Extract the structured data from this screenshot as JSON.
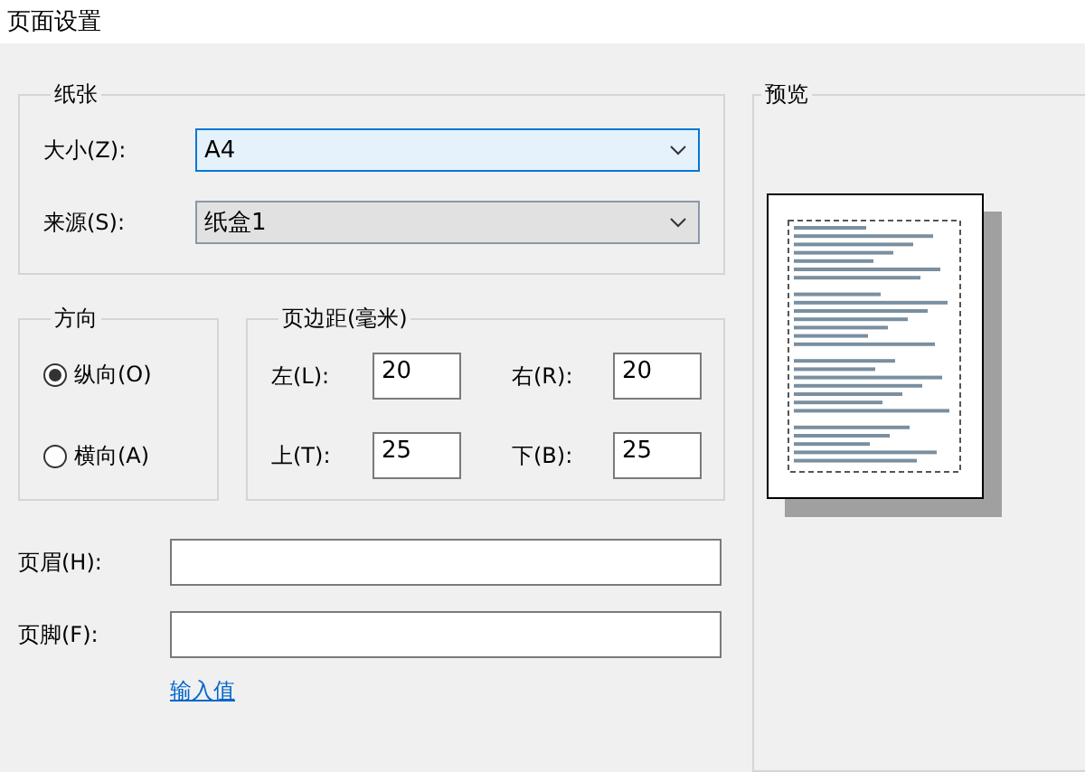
{
  "window": {
    "title": "页面设置"
  },
  "paper": {
    "title": "纸张",
    "size": {
      "label": "大小(Z):",
      "value": "A4",
      "focused": true
    },
    "source": {
      "label": "来源(S):",
      "value": "纸盒1",
      "focused": false
    }
  },
  "orientation": {
    "title": "方向",
    "options": [
      {
        "label": "纵向(O)",
        "selected": true
      },
      {
        "label": "横向(A)",
        "selected": false
      }
    ]
  },
  "margins": {
    "title": "页边距(毫米)",
    "fields": [
      {
        "label": "左(L):",
        "value": "20"
      },
      {
        "label": "右(R):",
        "value": "20"
      },
      {
        "label": "上(T):",
        "value": "25"
      },
      {
        "label": "下(B):",
        "value": "25"
      }
    ]
  },
  "header": {
    "label": "页眉(H):"
  },
  "footer": {
    "label": "页脚(F):"
  },
  "link": "输入值",
  "preview": {
    "title": "预览"
  }
}
